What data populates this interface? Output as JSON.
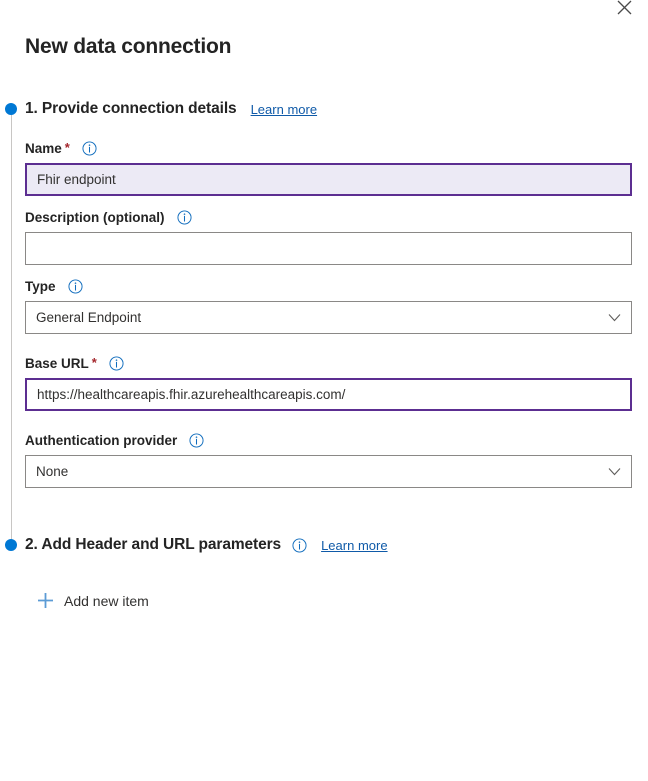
{
  "panel": {
    "title": "New data connection",
    "close_icon": "close-icon"
  },
  "colors": {
    "accent_blue": "#0078d4",
    "link_blue": "#0f5aa8",
    "focus_purple": "#5c2e91",
    "focus_fill": "#eceaf5",
    "required_red": "#a4262c",
    "plus_blue": "#5b9bd5",
    "border_gray": "#8a8886"
  },
  "steps": [
    {
      "title": "1. Provide connection details",
      "learn_more": "Learn more",
      "has_info_icon": false,
      "fields": [
        {
          "label": "Name",
          "required": true,
          "info_icon": "info-icon",
          "type": "text",
          "value": "Fhir endpoint",
          "placeholder": "",
          "state": "focused"
        },
        {
          "label": "Description (optional)",
          "required": false,
          "info_icon": "info-icon",
          "type": "text",
          "value": "",
          "placeholder": "",
          "state": "default"
        },
        {
          "label": "Type",
          "required": false,
          "info_icon": "info-icon",
          "type": "select",
          "value": "General Endpoint",
          "state": "default"
        },
        {
          "label": "Base URL",
          "required": true,
          "info_icon": "info-icon",
          "type": "text",
          "value": "https://healthcareapis.fhir.azurehealthcareapis.com/",
          "placeholder": "",
          "state": "outlined"
        },
        {
          "label": "Authentication provider",
          "required": false,
          "info_icon": "info-icon",
          "type": "select",
          "value": "None",
          "state": "default"
        }
      ]
    },
    {
      "title": "2. Add Header and URL parameters",
      "learn_more": "Learn more",
      "has_info_icon": true,
      "add_item": {
        "label": "Add new item",
        "icon": "plus-icon"
      }
    }
  ]
}
